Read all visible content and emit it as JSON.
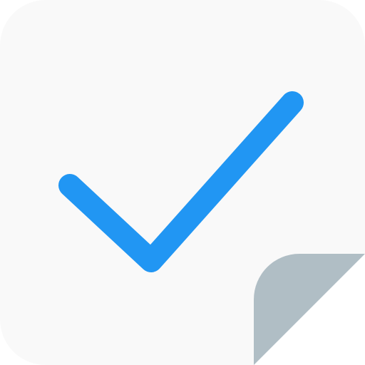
{
  "icon": {
    "name": "note-check-icon",
    "parts": {
      "sheet": "sheet-icon",
      "check": "checkmark-icon",
      "fold": "page-curl-icon"
    }
  },
  "colors": {
    "sheet": "#f9f9f9",
    "check": "#2196f3",
    "fold": "#b0bec5",
    "background": "#ffffff"
  }
}
